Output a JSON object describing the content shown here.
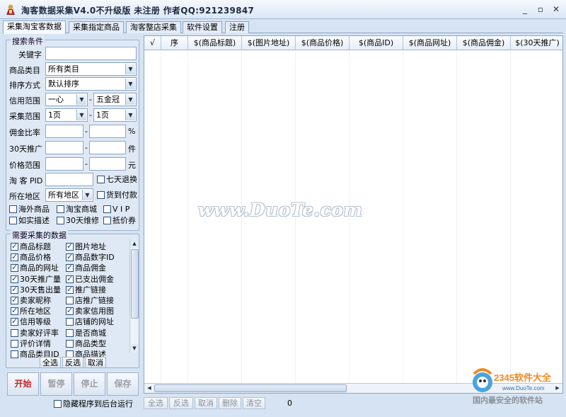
{
  "window": {
    "title": "淘客数据采集V4.0不升级版  未注册  作者QQ:921239847"
  },
  "tabs": [
    {
      "label": "采集淘宝客数据",
      "active": true
    },
    {
      "label": "采集指定商品",
      "active": false
    },
    {
      "label": "淘客整店采集",
      "active": false
    },
    {
      "label": "软件设置",
      "active": false
    },
    {
      "label": "注册",
      "active": false
    }
  ],
  "search": {
    "group_title": "搜索条件",
    "keyword_label": "关键字",
    "keyword_value": "",
    "category_label": "商品类目",
    "category_value": "所有类目",
    "sort_label": "排序方式",
    "sort_value": "默认排序",
    "credit_label": "信用范围",
    "credit_from": "一心",
    "credit_to": "五金冠",
    "pages_label": "采集范围",
    "pages_from": "1页",
    "pages_to": "1页",
    "commission_label": "佣金比率",
    "commission_unit": "%",
    "promo30_label": "30天推广",
    "promo30_unit": "件",
    "price_label": "价格范围",
    "price_unit": "元",
    "pid_label": "淘 客 PID",
    "pid_value": "",
    "region_label": "所在地区",
    "region_value": "所有地区",
    "range_sep": "-",
    "checks": {
      "seven_day": "七天退换",
      "cod": "货到付款",
      "overseas": "海外商品",
      "tmall": "淘宝商城",
      "vip": "V I P",
      "as_described": "如实描述",
      "repair30": "30天维修",
      "coupon": "抵价券"
    }
  },
  "fields": {
    "group_title": "需要采集的数据",
    "items_left": [
      {
        "label": "商品标题",
        "checked": true
      },
      {
        "label": "商品价格",
        "checked": true
      },
      {
        "label": "商品的网址",
        "checked": true
      },
      {
        "label": "30天推广量",
        "checked": true
      },
      {
        "label": "30天售出量",
        "checked": true
      },
      {
        "label": "卖家昵称",
        "checked": true
      },
      {
        "label": "所在地区",
        "checked": true
      },
      {
        "label": "信用等级",
        "checked": true
      },
      {
        "label": "卖家好评率",
        "checked": false
      },
      {
        "label": "评价详情",
        "checked": false
      },
      {
        "label": "商品类目ID",
        "checked": false
      }
    ],
    "items_right": [
      {
        "label": "图片地址",
        "checked": true
      },
      {
        "label": "商品数字ID",
        "checked": true
      },
      {
        "label": "商品佣金",
        "checked": true
      },
      {
        "label": "已支出佣金",
        "checked": true
      },
      {
        "label": "推广链接",
        "checked": true
      },
      {
        "label": "店推广链接",
        "checked": false
      },
      {
        "label": "卖家信用图",
        "checked": true
      },
      {
        "label": "店铺的网址",
        "checked": false
      },
      {
        "label": "是否商城",
        "checked": false
      },
      {
        "label": "商品类型",
        "checked": false
      },
      {
        "label": "商品描述",
        "checked": false
      }
    ],
    "select_all": "全选",
    "invert": "反选",
    "cancel": "取消"
  },
  "actions": {
    "start": "开始",
    "pause": "暂停",
    "stop": "停止",
    "save": "保存",
    "hide_bg": "隐藏程序到后台运行"
  },
  "grid": {
    "columns": [
      "√",
      "序",
      "$(商品标题)",
      "$(图片地址)",
      "$(商品价格)",
      "$(商品ID)",
      "$(商品网址)",
      "$(商品佣金)",
      "$(30天推广)"
    ]
  },
  "grid_actions": {
    "select_all": "全选",
    "invert": "反选",
    "cancel": "取消",
    "delete": "删除",
    "clear": "清空",
    "count": "0"
  },
  "watermark": "www.DuoTe.com",
  "brand": {
    "name": "2345软件大全",
    "url": "www.DuoTe.com",
    "slogan": "国内最安全的软件站"
  }
}
